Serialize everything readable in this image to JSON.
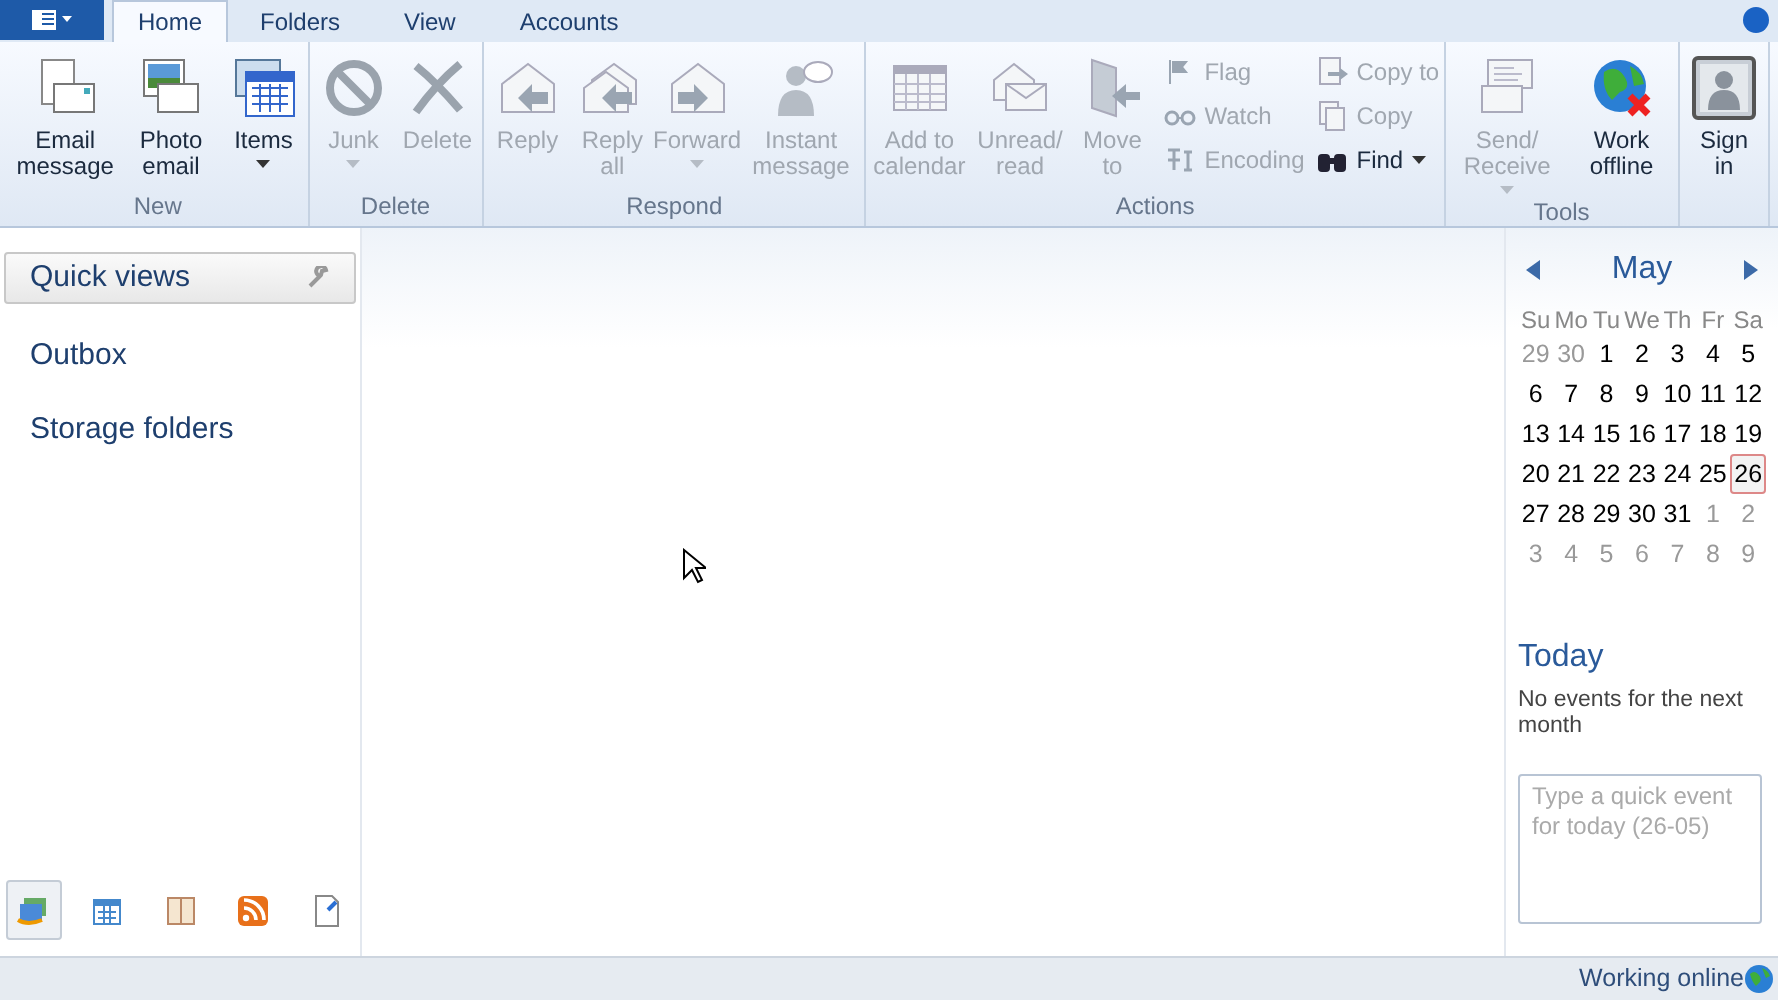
{
  "tabs": [
    {
      "label": "Home",
      "selected": true
    },
    {
      "label": "Folders",
      "selected": false
    },
    {
      "label": "View",
      "selected": false
    },
    {
      "label": "Accounts",
      "selected": false
    }
  ],
  "ribbon_groups": [
    {
      "title": "New",
      "buttons": [
        {
          "kind": "large",
          "label": "Email message",
          "disabled": false,
          "dropdown": false
        },
        {
          "kind": "large",
          "label": "Photo email",
          "disabled": false,
          "dropdown": false
        },
        {
          "kind": "large",
          "label": "Items",
          "disabled": false,
          "dropdown": true
        }
      ]
    },
    {
      "title": "Delete",
      "buttons": [
        {
          "kind": "large",
          "label": "Junk",
          "disabled": true,
          "dropdown": true
        },
        {
          "kind": "large",
          "label": "Delete",
          "disabled": true,
          "dropdown": false
        }
      ]
    },
    {
      "title": "Respond",
      "buttons": [
        {
          "kind": "large",
          "label": "Reply",
          "disabled": true,
          "dropdown": false
        },
        {
          "kind": "large",
          "label": "Reply all",
          "disabled": true,
          "dropdown": false
        },
        {
          "kind": "large",
          "label": "Forward",
          "disabled": true,
          "dropdown": true
        },
        {
          "kind": "large",
          "label": "Instant message",
          "disabled": true,
          "dropdown": false
        }
      ]
    },
    {
      "title": "Actions",
      "buttons": [
        {
          "kind": "large",
          "label": "Add to calendar",
          "disabled": true,
          "dropdown": false
        },
        {
          "kind": "large",
          "label": "Unread/ read",
          "disabled": true,
          "dropdown": false
        },
        {
          "kind": "large",
          "label": "Move to",
          "disabled": true,
          "dropdown": false
        },
        {
          "kind": "small",
          "label": "Flag",
          "disabled": true,
          "dropdown": false
        },
        {
          "kind": "small",
          "label": "Watch",
          "disabled": true,
          "dropdown": false
        },
        {
          "kind": "small",
          "label": "Encoding",
          "disabled": true,
          "dropdown": false
        },
        {
          "kind": "small",
          "label": "Copy to",
          "disabled": true,
          "dropdown": false
        },
        {
          "kind": "small",
          "label": "Copy",
          "disabled": true,
          "dropdown": false
        },
        {
          "kind": "small",
          "label": "Find",
          "disabled": false,
          "dropdown": true
        }
      ]
    },
    {
      "title": "Tools",
      "buttons": [
        {
          "kind": "large",
          "label": "Send/ Receive",
          "disabled": true,
          "dropdown": true
        },
        {
          "kind": "large",
          "label": "Work offline",
          "disabled": false,
          "dropdown": false
        }
      ]
    },
    {
      "buttons": [
        {
          "kind": "large",
          "label": "Sign in",
          "disabled": false,
          "dropdown": false
        }
      ]
    }
  ],
  "sidebar": {
    "header": "Quick views",
    "items": [
      "Outbox",
      "Storage folders"
    ]
  },
  "nav_icons": [
    {
      "selected": true
    },
    {
      "selected": false
    },
    {
      "selected": false
    },
    {
      "selected": false
    },
    {
      "selected": false
    }
  ],
  "calendar": {
    "month": "May",
    "weekdays": [
      "Su",
      "Mo",
      "Tu",
      "We",
      "Th",
      "Fr",
      "Sa"
    ],
    "days": [
      {
        "label": "29",
        "in_month": false,
        "selected": false
      },
      {
        "label": "30",
        "in_month": false,
        "selected": false
      },
      {
        "label": "1",
        "in_month": true,
        "selected": false
      },
      {
        "label": "2",
        "in_month": true,
        "selected": false
      },
      {
        "label": "3",
        "in_month": true,
        "selected": false
      },
      {
        "label": "4",
        "in_month": true,
        "selected": false
      },
      {
        "label": "5",
        "in_month": true,
        "selected": false
      },
      {
        "label": "6",
        "in_month": true,
        "selected": false
      },
      {
        "label": "7",
        "in_month": true,
        "selected": false
      },
      {
        "label": "8",
        "in_month": true,
        "selected": false
      },
      {
        "label": "9",
        "in_month": true,
        "selected": false
      },
      {
        "label": "10",
        "in_month": true,
        "selected": false
      },
      {
        "label": "11",
        "in_month": true,
        "selected": false
      },
      {
        "label": "12",
        "in_month": true,
        "selected": false
      },
      {
        "label": "13",
        "in_month": true,
        "selected": false
      },
      {
        "label": "14",
        "in_month": true,
        "selected": false
      },
      {
        "label": "15",
        "in_month": true,
        "selected": false
      },
      {
        "label": "16",
        "in_month": true,
        "selected": false
      },
      {
        "label": "17",
        "in_month": true,
        "selected": false
      },
      {
        "label": "18",
        "in_month": true,
        "selected": false
      },
      {
        "label": "19",
        "in_month": true,
        "selected": false
      },
      {
        "label": "20",
        "in_month": true,
        "selected": false
      },
      {
        "label": "21",
        "in_month": true,
        "selected": false
      },
      {
        "label": "22",
        "in_month": true,
        "selected": false
      },
      {
        "label": "23",
        "in_month": true,
        "selected": false
      },
      {
        "label": "24",
        "in_month": true,
        "selected": false
      },
      {
        "label": "25",
        "in_month": true,
        "selected": false
      },
      {
        "label": "26",
        "in_month": true,
        "selected": true
      },
      {
        "label": "27",
        "in_month": true,
        "selected": false
      },
      {
        "label": "28",
        "in_month": true,
        "selected": false
      },
      {
        "label": "29",
        "in_month": true,
        "selected": false
      },
      {
        "label": "30",
        "in_month": true,
        "selected": false
      },
      {
        "label": "31",
        "in_month": true,
        "selected": false
      },
      {
        "label": "1",
        "in_month": false,
        "selected": false
      },
      {
        "label": "2",
        "in_month": false,
        "selected": false
      },
      {
        "label": "3",
        "in_month": false,
        "selected": false
      },
      {
        "label": "4",
        "in_month": false,
        "selected": false
      },
      {
        "label": "5",
        "in_month": false,
        "selected": false
      },
      {
        "label": "6",
        "in_month": false,
        "selected": false
      },
      {
        "label": "7",
        "in_month": false,
        "selected": false
      },
      {
        "label": "8",
        "in_month": false,
        "selected": false
      },
      {
        "label": "9",
        "in_month": false,
        "selected": false
      }
    ]
  },
  "today": {
    "title": "Today",
    "message": "No events for the next month",
    "quick_event": {
      "placeholder": "Type a quick event for today (26-05)"
    }
  },
  "status_bar": {
    "text": "Working online"
  }
}
